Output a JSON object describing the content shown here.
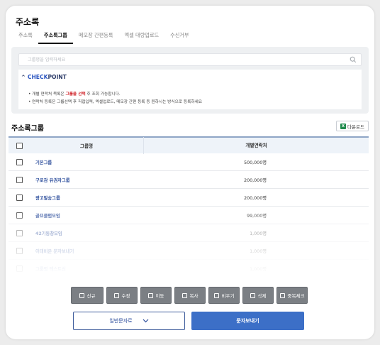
{
  "header": {
    "title": "주소록"
  },
  "tabs": [
    {
      "label": "주소록"
    },
    {
      "label": "주소록그룹"
    },
    {
      "label": "메모장 간편등록"
    },
    {
      "label": "엑셀 대량업로드"
    },
    {
      "label": "수신거부"
    }
  ],
  "search": {
    "placeholder": "그룹명을 입력하세요"
  },
  "checkpoint": {
    "caret": "^",
    "title_check": "CHECK",
    "title_point": "POINT",
    "line1_pre": "개별 연락처 목록은 ",
    "line1_highlight": "그룹을 선택",
    "line1_post": " 후 조회 가능합니다.",
    "line2": "연락처 등록은 그룹선택 후 직접입력, 엑셀업로드, 메모장 간편 등록 등 원하시는 방식으로 등록하세요"
  },
  "section": {
    "title": "주소록그룹",
    "download_label": "다운로드",
    "download_icon": "excel-icon"
  },
  "table": {
    "columns": [
      "그룹명",
      "개별연락처"
    ],
    "rows": [
      {
        "name": "기본그룹",
        "count": "500,000명"
      },
      {
        "name": "구로감 유권자그룹",
        "count": "200,000명"
      },
      {
        "name": "광고발송그룹",
        "count": "200,000명"
      },
      {
        "name": "골프클럽모임",
        "count": "99,000명"
      },
      {
        "name": "42기동창모임",
        "count": "1,000명"
      },
      {
        "name": "이태비운 문자보내기",
        "count": "1,000명"
      },
      {
        "name": "그룹명 텍스트신",
        "count": "1,000명"
      }
    ]
  },
  "actions": [
    {
      "label": "신규",
      "icon": "new-icon"
    },
    {
      "label": "수정",
      "icon": "edit-icon"
    },
    {
      "label": "이동",
      "icon": "move-icon"
    },
    {
      "label": "복사",
      "icon": "copy-icon"
    },
    {
      "label": "비우기",
      "icon": "empty-icon"
    },
    {
      "label": "삭제",
      "icon": "delete-icon"
    },
    {
      "label": "중복체크",
      "icon": "duplicate-check-icon"
    }
  ],
  "footer": {
    "normal_label": "일반문자로",
    "send_label": "문자보내기"
  },
  "colors": {
    "accent": "#3c6fc7",
    "highlight": "#d0282e",
    "action_gray": "#7b7f84",
    "link": "#2d4e9c"
  }
}
